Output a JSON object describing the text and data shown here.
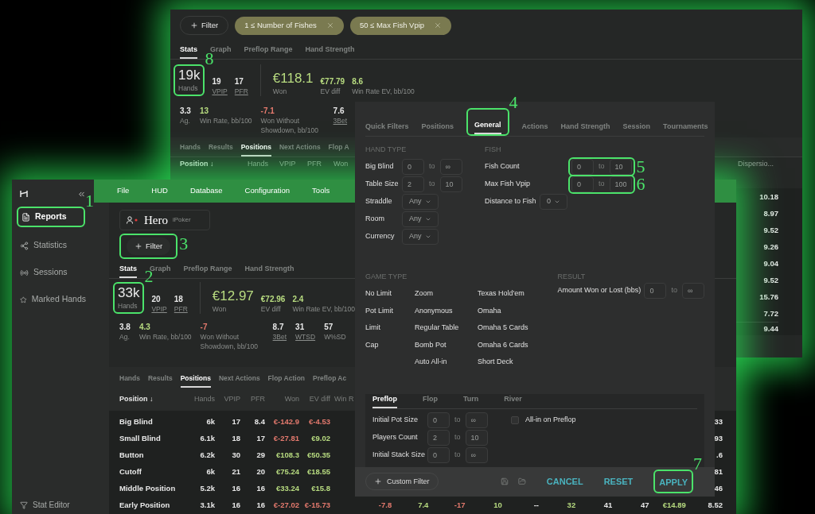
{
  "back_window": {
    "filter_button": "Filter",
    "chips": [
      "1 ≤ Number of Fishes",
      "50 ≤ Max Fish Vpip"
    ],
    "tabs": [
      {
        "label": "Stats",
        "selected": true
      },
      {
        "label": "Graph",
        "selected": false
      },
      {
        "label": "Preflop Range",
        "selected": false
      },
      {
        "label": "Hand Strength",
        "selected": false
      }
    ],
    "stats": [
      {
        "value": "19k",
        "label": "Hands",
        "kind": "headline",
        "underlined": false,
        "annotation": "8"
      },
      {
        "value": "19",
        "label": "VPIP",
        "kind": "detail",
        "underlined": true
      },
      {
        "value": "17",
        "label": "PFR",
        "kind": "detail",
        "underlined": true
      },
      {
        "value": "€118.1",
        "label": "Won",
        "kind": "headline",
        "underlined": false,
        "color": "#b8dc80"
      },
      {
        "value": "€77.79",
        "label": "EV diff",
        "kind": "detail",
        "underlined": false,
        "color": "#b8dc80"
      },
      {
        "value": "8.6",
        "label": "Win Rate EV, bb/100",
        "kind": "detail",
        "underlined": false,
        "color": "#b8dc80"
      }
    ],
    "stats_row_2": [
      {
        "value": "3.3",
        "label": "Ag.",
        "underlined": false
      },
      {
        "value": "13",
        "label": "Win Rate, bb/100",
        "underlined": false,
        "color": "#b8dc80"
      },
      {
        "value": "-7.1",
        "label": "Won Without Showdown, bb/100",
        "underlined": false,
        "color": "#e57a6e"
      },
      {
        "value": "7.6",
        "label": "3Bet",
        "underlined": true
      }
    ],
    "subtabs": [
      {
        "label": "Hands",
        "selected": false
      },
      {
        "label": "Results",
        "selected": false
      },
      {
        "label": "Positions",
        "selected": true
      },
      {
        "label": "Next Actions",
        "selected": false
      },
      {
        "label": "Flop A",
        "selected": false
      }
    ],
    "columns": [
      "Position ↓",
      "Hands",
      "VPIP",
      "PFR",
      "Won"
    ],
    "right_column": {
      "header": "Dispersio...",
      "values": [
        "10.18",
        "8.97",
        "9.52",
        "9.26",
        "9.04",
        "9.52",
        "15.76",
        "7.72"
      ],
      "total": "9.44"
    }
  },
  "main_window": {
    "sidebar": {
      "items": [
        {
          "label": "Reports",
          "selected": true,
          "annotation": "1"
        },
        {
          "label": "Statistics",
          "selected": false
        },
        {
          "label": "Sessions",
          "selected": false
        },
        {
          "label": "Marked Hands",
          "selected": false
        }
      ],
      "footer": "Stat Editor"
    },
    "menu": [
      "File",
      "HUD",
      "Database",
      "Configuration",
      "Tools"
    ],
    "profile": {
      "name": "Hero",
      "room": "iPoker"
    },
    "filter_button": {
      "label": "Filter",
      "annotation": "3"
    },
    "tabs": [
      {
        "label": "Stats",
        "selected": true
      },
      {
        "label": "Graph",
        "selected": false
      },
      {
        "label": "Preflop Range",
        "selected": false
      },
      {
        "label": "Hand Strength",
        "selected": false
      }
    ],
    "stats": [
      {
        "value": "33k",
        "label": "Hands",
        "kind": "headline",
        "underlined": false,
        "annotation": "2"
      },
      {
        "value": "20",
        "label": "VPIP",
        "kind": "detail",
        "underlined": true
      },
      {
        "value": "18",
        "label": "PFR",
        "kind": "detail",
        "underlined": true
      },
      {
        "value": "€12.97",
        "label": "Won",
        "kind": "headline",
        "underlined": false,
        "color": "#b8dc80"
      },
      {
        "value": "€72.96",
        "label": "EV diff",
        "kind": "detail",
        "underlined": false,
        "color": "#b8dc80"
      },
      {
        "value": "2.4",
        "label": "Win Rate EV, bb/100",
        "kind": "detail",
        "underlined": false,
        "color": "#b8dc80"
      }
    ],
    "stats_row_2": [
      {
        "value": "3.8",
        "label": "Ag.",
        "underlined": false
      },
      {
        "value": "4.3",
        "label": "Win Rate, bb/100",
        "underlined": false,
        "color": "#b8dc80"
      },
      {
        "value": "-7",
        "label": "Won Without Showdown, bb/100",
        "underlined": false,
        "color": "#e57a6e"
      },
      {
        "value": "8.7",
        "label": "3Bet",
        "underlined": true
      },
      {
        "value": "31",
        "label": "WTSD",
        "underlined": true
      },
      {
        "value": "57",
        "label": "W%SD",
        "underlined": false
      }
    ],
    "subtabs": [
      {
        "label": "Hands",
        "selected": false
      },
      {
        "label": "Results",
        "selected": false
      },
      {
        "label": "Positions",
        "selected": true
      },
      {
        "label": "Next Actions",
        "selected": false
      },
      {
        "label": "Flop Action",
        "selected": false
      },
      {
        "label": "Preflop Ac",
        "selected": false
      }
    ],
    "columns": [
      "Position ↓",
      "Hands",
      "VPIP",
      "PFR",
      "Won",
      "EV diff",
      "Win R"
    ],
    "rows": [
      {
        "cells": [
          {
            "text": "Big Blind"
          },
          {
            "text": "6k"
          },
          {
            "text": "17"
          },
          {
            "text": "8.4"
          },
          {
            "text": "€-142.9",
            "color": "#e57a6e"
          },
          {
            "text": "€-4.53",
            "color": "#e57a6e"
          }
        ],
        "tail": [
          {
            "text": "33"
          }
        ]
      },
      {
        "cells": [
          {
            "text": "Small Blind"
          },
          {
            "text": "6.1k"
          },
          {
            "text": "18"
          },
          {
            "text": "17"
          },
          {
            "text": "€-27.81",
            "color": "#e57a6e"
          },
          {
            "text": "€9.02",
            "color": "#b8dc80"
          }
        ],
        "tail": [
          {
            "text": "93"
          }
        ]
      },
      {
        "cells": [
          {
            "text": "Button"
          },
          {
            "text": "6.2k"
          },
          {
            "text": "30"
          },
          {
            "text": "29"
          },
          {
            "text": "€108.3",
            "color": "#b8dc80"
          },
          {
            "text": "€50.35",
            "color": "#b8dc80"
          }
        ],
        "tail": [
          {
            "text": ".6"
          }
        ]
      },
      {
        "cells": [
          {
            "text": "Cutoff"
          },
          {
            "text": "6k"
          },
          {
            "text": "21"
          },
          {
            "text": "20"
          },
          {
            "text": "€75.24",
            "color": "#b8dc80"
          },
          {
            "text": "€18.55",
            "color": "#b8dc80"
          }
        ],
        "tail": [
          {
            "text": "81"
          }
        ]
      },
      {
        "cells": [
          {
            "text": "Middle Position"
          },
          {
            "text": "5.2k"
          },
          {
            "text": "16"
          },
          {
            "text": "16"
          },
          {
            "text": "€33.24",
            "color": "#b8dc80"
          },
          {
            "text": "€15.8",
            "color": "#b8dc80"
          }
        ],
        "tail": [
          {
            "text": "46"
          }
        ]
      },
      {
        "cells": [
          {
            "text": "Early Position"
          },
          {
            "text": "3.1k"
          },
          {
            "text": "16"
          },
          {
            "text": "16"
          },
          {
            "text": "€-27.02",
            "color": "#e57a6e"
          },
          {
            "text": "€-15.73",
            "color": "#e57a6e"
          }
        ],
        "tail": [
          {
            "text": "-7.8",
            "color": "#e57a6e"
          },
          {
            "text": "7.4",
            "color": "#b8dc80"
          },
          {
            "text": "-17",
            "color": "#e57a6e"
          },
          {
            "text": "10",
            "color": "#b8dc80"
          },
          {
            "text": "--"
          },
          {
            "text": "32",
            "color": "#b8dc80"
          },
          {
            "text": "41"
          },
          {
            "text": "47"
          },
          {
            "text": "€14.89",
            "color": "#b8dc80"
          },
          {
            "text": "8.52"
          }
        ]
      }
    ]
  },
  "filter_dialog": {
    "tabs": [
      {
        "label": "Quick Filters",
        "selected": false
      },
      {
        "label": "Positions",
        "selected": false
      },
      {
        "label": "General",
        "selected": true,
        "annotation": "4"
      },
      {
        "label": "Actions",
        "selected": false
      },
      {
        "label": "Hand Strength",
        "selected": false
      },
      {
        "label": "Session",
        "selected": false
      },
      {
        "label": "Tournaments",
        "selected": false
      }
    ],
    "hand_type": {
      "heading": "HAND TYPE",
      "rows": [
        {
          "kind": "range",
          "label": "Big Blind",
          "from": "0",
          "separator": "to",
          "to": "∞"
        },
        {
          "kind": "range",
          "label": "Table Size",
          "from": "2",
          "separator": "to",
          "to": "10"
        },
        {
          "kind": "select",
          "label": "Straddle",
          "value": "Any"
        },
        {
          "kind": "select",
          "label": "Room",
          "value": "Any"
        },
        {
          "kind": "select",
          "label": "Currency",
          "value": "Any"
        }
      ]
    },
    "fish": {
      "heading": "FISH",
      "rows": [
        {
          "kind": "range",
          "label": "Fish Count",
          "from": "0",
          "separator": "to",
          "to": "10",
          "annotation": "5"
        },
        {
          "kind": "range",
          "label": "Max Fish Vpip",
          "from": "0",
          "separator": "to",
          "to": "100",
          "annotation": "6"
        },
        {
          "kind": "select",
          "label": "Distance to Fish",
          "value": "0"
        }
      ]
    },
    "game_type": {
      "heading": "GAME TYPE",
      "columns": [
        [
          "No Limit",
          "Pot Limit",
          "Limit",
          "Cap"
        ],
        [
          "Zoom",
          "Anonymous",
          "Regular Table",
          "Bomb Pot",
          "Auto All-in"
        ],
        [
          "Texas Hold'em",
          "Omaha",
          "Omaha 5 Cards",
          "Omaha 6 Cards",
          "Short Deck"
        ]
      ]
    },
    "result": {
      "heading": "RESULT",
      "rows": [
        {
          "kind": "range",
          "label": "Amount Won or Lost (bbs)",
          "from": "0",
          "separator": "to",
          "to": "∞"
        }
      ]
    },
    "streets": {
      "tabs": [
        {
          "label": "Preflop",
          "selected": true
        },
        {
          "label": "Flop",
          "selected": false
        },
        {
          "label": "Turn",
          "selected": false
        },
        {
          "label": "River",
          "selected": false
        }
      ],
      "rows": [
        {
          "kind": "range",
          "label": "Initial Pot Size",
          "from": "0",
          "separator": "to",
          "to": "∞"
        },
        {
          "kind": "range",
          "label": "Players Count",
          "from": "2",
          "separator": "to",
          "to": "10"
        },
        {
          "kind": "range",
          "label": "Initial Stack Size",
          "from": "0",
          "separator": "to",
          "to": "∞"
        }
      ],
      "checkbox": {
        "label": "All-in on Preflop",
        "checked": false
      }
    },
    "footer": {
      "custom_filter": "Custom Filter",
      "actions": [
        {
          "label": "CANCEL"
        },
        {
          "label": "RESET"
        },
        {
          "label": "APPLY",
          "annotation": "7"
        }
      ]
    }
  }
}
